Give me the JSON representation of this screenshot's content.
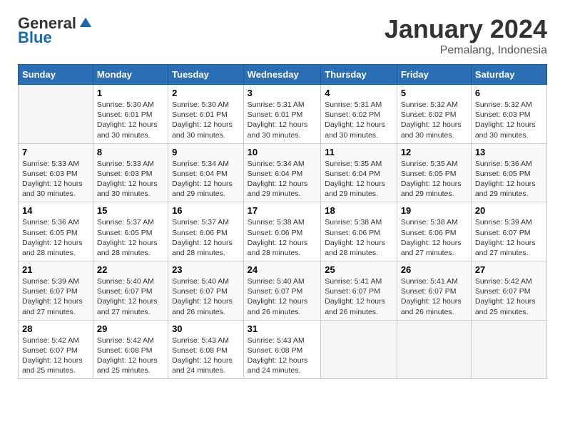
{
  "header": {
    "logo_general": "General",
    "logo_blue": "Blue",
    "month_title": "January 2024",
    "location": "Pemalang, Indonesia"
  },
  "days_of_week": [
    "Sunday",
    "Monday",
    "Tuesday",
    "Wednesday",
    "Thursday",
    "Friday",
    "Saturday"
  ],
  "weeks": [
    [
      {
        "day": "",
        "info": ""
      },
      {
        "day": "1",
        "info": "Sunrise: 5:30 AM\nSunset: 6:01 PM\nDaylight: 12 hours\nand 30 minutes."
      },
      {
        "day": "2",
        "info": "Sunrise: 5:30 AM\nSunset: 6:01 PM\nDaylight: 12 hours\nand 30 minutes."
      },
      {
        "day": "3",
        "info": "Sunrise: 5:31 AM\nSunset: 6:01 PM\nDaylight: 12 hours\nand 30 minutes."
      },
      {
        "day": "4",
        "info": "Sunrise: 5:31 AM\nSunset: 6:02 PM\nDaylight: 12 hours\nand 30 minutes."
      },
      {
        "day": "5",
        "info": "Sunrise: 5:32 AM\nSunset: 6:02 PM\nDaylight: 12 hours\nand 30 minutes."
      },
      {
        "day": "6",
        "info": "Sunrise: 5:32 AM\nSunset: 6:03 PM\nDaylight: 12 hours\nand 30 minutes."
      }
    ],
    [
      {
        "day": "7",
        "info": "Sunrise: 5:33 AM\nSunset: 6:03 PM\nDaylight: 12 hours\nand 30 minutes."
      },
      {
        "day": "8",
        "info": "Sunrise: 5:33 AM\nSunset: 6:03 PM\nDaylight: 12 hours\nand 30 minutes."
      },
      {
        "day": "9",
        "info": "Sunrise: 5:34 AM\nSunset: 6:04 PM\nDaylight: 12 hours\nand 29 minutes."
      },
      {
        "day": "10",
        "info": "Sunrise: 5:34 AM\nSunset: 6:04 PM\nDaylight: 12 hours\nand 29 minutes."
      },
      {
        "day": "11",
        "info": "Sunrise: 5:35 AM\nSunset: 6:04 PM\nDaylight: 12 hours\nand 29 minutes."
      },
      {
        "day": "12",
        "info": "Sunrise: 5:35 AM\nSunset: 6:05 PM\nDaylight: 12 hours\nand 29 minutes."
      },
      {
        "day": "13",
        "info": "Sunrise: 5:36 AM\nSunset: 6:05 PM\nDaylight: 12 hours\nand 29 minutes."
      }
    ],
    [
      {
        "day": "14",
        "info": "Sunrise: 5:36 AM\nSunset: 6:05 PM\nDaylight: 12 hours\nand 28 minutes."
      },
      {
        "day": "15",
        "info": "Sunrise: 5:37 AM\nSunset: 6:05 PM\nDaylight: 12 hours\nand 28 minutes."
      },
      {
        "day": "16",
        "info": "Sunrise: 5:37 AM\nSunset: 6:06 PM\nDaylight: 12 hours\nand 28 minutes."
      },
      {
        "day": "17",
        "info": "Sunrise: 5:38 AM\nSunset: 6:06 PM\nDaylight: 12 hours\nand 28 minutes."
      },
      {
        "day": "18",
        "info": "Sunrise: 5:38 AM\nSunset: 6:06 PM\nDaylight: 12 hours\nand 28 minutes."
      },
      {
        "day": "19",
        "info": "Sunrise: 5:38 AM\nSunset: 6:06 PM\nDaylight: 12 hours\nand 27 minutes."
      },
      {
        "day": "20",
        "info": "Sunrise: 5:39 AM\nSunset: 6:07 PM\nDaylight: 12 hours\nand 27 minutes."
      }
    ],
    [
      {
        "day": "21",
        "info": "Sunrise: 5:39 AM\nSunset: 6:07 PM\nDaylight: 12 hours\nand 27 minutes."
      },
      {
        "day": "22",
        "info": "Sunrise: 5:40 AM\nSunset: 6:07 PM\nDaylight: 12 hours\nand 27 minutes."
      },
      {
        "day": "23",
        "info": "Sunrise: 5:40 AM\nSunset: 6:07 PM\nDaylight: 12 hours\nand 26 minutes."
      },
      {
        "day": "24",
        "info": "Sunrise: 5:40 AM\nSunset: 6:07 PM\nDaylight: 12 hours\nand 26 minutes."
      },
      {
        "day": "25",
        "info": "Sunrise: 5:41 AM\nSunset: 6:07 PM\nDaylight: 12 hours\nand 26 minutes."
      },
      {
        "day": "26",
        "info": "Sunrise: 5:41 AM\nSunset: 6:07 PM\nDaylight: 12 hours\nand 26 minutes."
      },
      {
        "day": "27",
        "info": "Sunrise: 5:42 AM\nSunset: 6:07 PM\nDaylight: 12 hours\nand 25 minutes."
      }
    ],
    [
      {
        "day": "28",
        "info": "Sunrise: 5:42 AM\nSunset: 6:07 PM\nDaylight: 12 hours\nand 25 minutes."
      },
      {
        "day": "29",
        "info": "Sunrise: 5:42 AM\nSunset: 6:08 PM\nDaylight: 12 hours\nand 25 minutes."
      },
      {
        "day": "30",
        "info": "Sunrise: 5:43 AM\nSunset: 6:08 PM\nDaylight: 12 hours\nand 24 minutes."
      },
      {
        "day": "31",
        "info": "Sunrise: 5:43 AM\nSunset: 6:08 PM\nDaylight: 12 hours\nand 24 minutes."
      },
      {
        "day": "",
        "info": ""
      },
      {
        "day": "",
        "info": ""
      },
      {
        "day": "",
        "info": ""
      }
    ]
  ]
}
